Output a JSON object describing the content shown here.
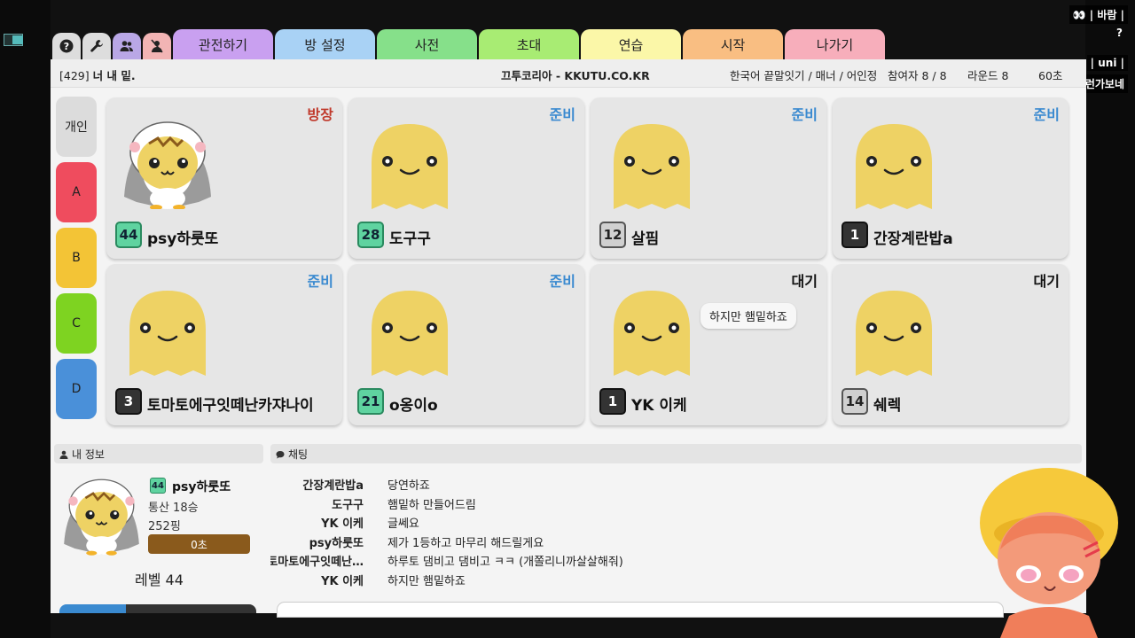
{
  "stream": {
    "overlay_top": "👀 | 바람 |",
    "overlay_help": "?",
    "overlay_user": "| uni |",
    "overlay_msg": "그런가보네"
  },
  "tabs": {
    "help_icon": "help-circle-icon",
    "settings_icon": "wrench-icon",
    "friends_icon": "users-icon",
    "kick_icon": "user-block-icon",
    "items": [
      {
        "label": "관전하기",
        "color": "#c9a0f0"
      },
      {
        "label": "방 설정",
        "color": "#a9d2f5"
      },
      {
        "label": "사전",
        "color": "#86e08a"
      },
      {
        "label": "초대",
        "color": "#a8ec73"
      },
      {
        "label": "연습",
        "color": "#fbf7a8"
      },
      {
        "label": "시작",
        "color": "#f9be82"
      },
      {
        "label": "나가기",
        "color": "#f7aebb"
      }
    ]
  },
  "room": {
    "title_prefix": "[429]",
    "title": "너 내 밑.",
    "site": "끄투코리아 - KKUTU.CO.KR",
    "mode": "한국어 끝말잇기 / 매너 / 어인정",
    "players": "참여자 8 / 8",
    "round": "라운드 8",
    "time": "60초"
  },
  "teams": [
    {
      "label": "개인",
      "color": "#dcdcdc"
    },
    {
      "label": "A",
      "color": "#ef4c5e"
    },
    {
      "label": "B",
      "color": "#f3c436"
    },
    {
      "label": "C",
      "color": "#7ed321"
    },
    {
      "label": "D",
      "color": "#4a90d9"
    }
  ],
  "players": [
    {
      "name": "psy하룻또",
      "level": "44",
      "status": "방장",
      "status_type": "host",
      "badge": "green",
      "avatar": "penguin"
    },
    {
      "name": "도구구",
      "level": "28",
      "status": "준비",
      "status_type": "ready",
      "badge": "green",
      "avatar": "blob"
    },
    {
      "name": "살핌",
      "level": "12",
      "status": "준비",
      "status_type": "ready",
      "badge": "gray",
      "avatar": "blob"
    },
    {
      "name": "간장계란밥a",
      "level": "1",
      "status": "준비",
      "status_type": "ready",
      "badge": "dark",
      "avatar": "blob"
    },
    {
      "name": "토마토에구잇떼난카쟈나이",
      "level": "3",
      "status": "준비",
      "status_type": "ready",
      "badge": "dark",
      "avatar": "blob"
    },
    {
      "name": "o옹이o",
      "level": "21",
      "status": "준비",
      "status_type": "ready",
      "badge": "green",
      "avatar": "blob"
    },
    {
      "name": "YK 이케",
      "level": "1",
      "status": "대기",
      "status_type": "wait",
      "badge": "dark",
      "avatar": "blob",
      "bubble": "하지만 햄밑하죠"
    },
    {
      "name": "쉐렉",
      "level": "14",
      "status": "대기",
      "status_type": "wait",
      "badge": "gray",
      "avatar": "blob"
    }
  ],
  "my_info": {
    "header": "내 정보",
    "name": "psy하룻또",
    "level_badge": "44",
    "wins": "통산 18승",
    "points": "252핑",
    "bar_label": "0초",
    "level_text": "레벨 44"
  },
  "chat": {
    "header": "채팅",
    "messages": [
      {
        "who": "간장계란밥a",
        "msg": "당연하죠"
      },
      {
        "who": "도구구",
        "msg": "햄밑하 만들어드림"
      },
      {
        "who": "YK 이케",
        "msg": "글쎄요"
      },
      {
        "who": "psy하룻또",
        "msg": "제가 1등하고 마무리 해드릴게요"
      },
      {
        "who": "토마토에구잇떼난…",
        "msg": "하루토 댐비고 댐비고 ㅋㅋ (개쫄리니까살살해줘)"
      },
      {
        "who": "YK 이케",
        "msg": "하지만 햄밑하죠"
      }
    ]
  }
}
